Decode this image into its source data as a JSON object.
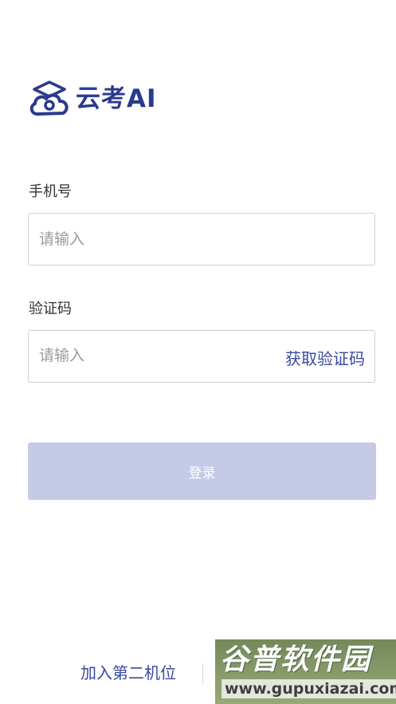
{
  "app": {
    "logo_text": "云考AI",
    "logo_icon": "cloud-graduation-cap-icon",
    "brand_color": "#2b3a8c"
  },
  "form": {
    "phone_label": "手机号",
    "phone_placeholder": "请输入",
    "code_label": "验证码",
    "code_placeholder": "请输入",
    "get_code_label": "获取验证码",
    "login_label": "登录",
    "login_button_color": "#c5cae6"
  },
  "footer": {
    "join_second_device": "加入第二机位"
  },
  "watermark": {
    "title": "谷普软件园",
    "url": "www.gupuxiazai.com"
  }
}
